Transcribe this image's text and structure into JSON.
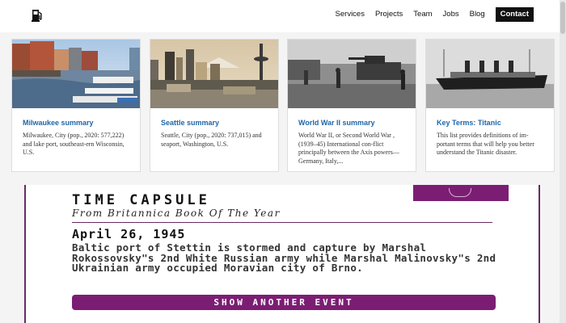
{
  "nav": {
    "items": [
      "Services",
      "Projects",
      "Team",
      "Jobs",
      "Blog"
    ],
    "contact": "Contact"
  },
  "icons": {
    "logo": "fuel-pump-icon"
  },
  "cards": [
    {
      "title": "Milwaukee summary",
      "description": "Milwaukee, City (pop., 2020: 577,222) and lake port, southeast-ern Wisconsin, U.S.",
      "image": "milwaukee-photo"
    },
    {
      "title": "Seattle summary",
      "description": "Seattle, City (pop., 2020: 737,015) and seaport, Washington, U.S.",
      "image": "seattle-photo"
    },
    {
      "title": "World War II summary",
      "description": "World War II, or Second World War , (1939–45) International con-flict principally between the Axis powers—Germany, Italy,...",
      "image": "ww2-photo"
    },
    {
      "title": "Key Terms: Titanic",
      "description": "This list provides definitions of im-portant terms that will help you better understand the Titanic disaster.",
      "image": "titanic-photo"
    }
  ],
  "time_capsule": {
    "title": "TIME CAPSULE",
    "subtitle": "From Britannica Book Of The Year",
    "date": "April 26, 1945",
    "event": "Baltic port of Stettin is stormed and capture by Marshal Rokossovsky\"s 2nd White Russian army while Marshal Malinovsky\"s 2nd Ukrainian army occupied Moravian city of Brno.",
    "button": "SHOW ANOTHER EVENT"
  },
  "colors": {
    "accent": "#7b1e73",
    "link": "#1f66a8"
  }
}
